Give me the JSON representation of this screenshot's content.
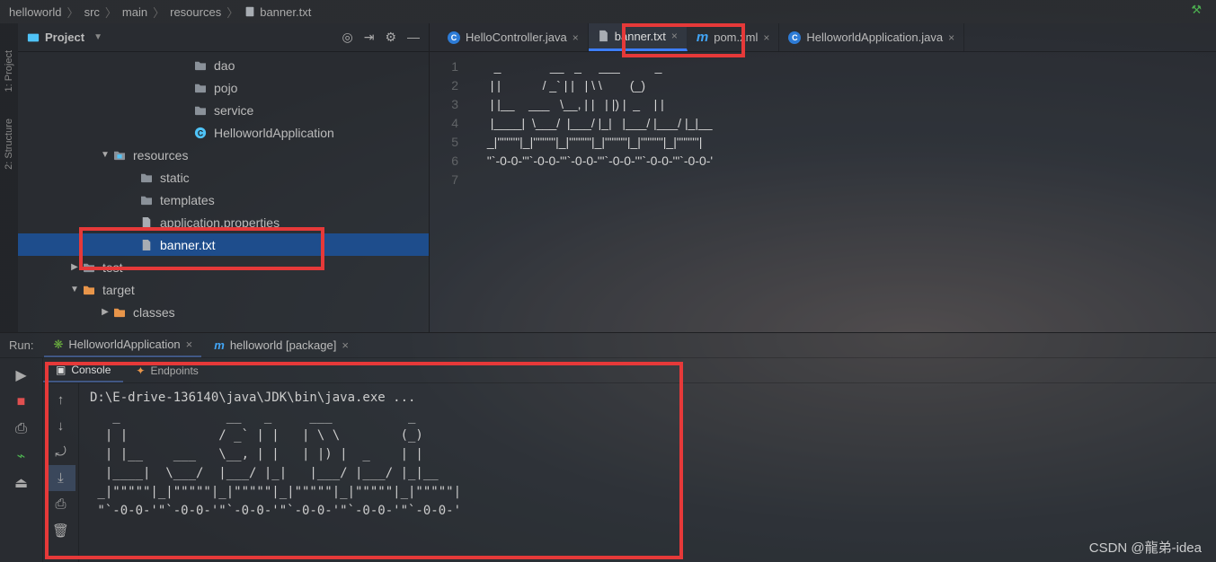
{
  "breadcrumb": {
    "items": [
      "helloworld",
      "src",
      "main",
      "resources",
      "banner.txt"
    ]
  },
  "sidebar": {
    "title": "Project",
    "tree": [
      {
        "label": "dao",
        "icon": "folder",
        "depth": 6
      },
      {
        "label": "pojo",
        "icon": "folder",
        "depth": 6
      },
      {
        "label": "service",
        "icon": "folder",
        "depth": 6
      },
      {
        "label": "HelloworldApplication",
        "icon": "class",
        "depth": 6
      },
      {
        "label": "resources",
        "icon": "folder-res",
        "depth": 4,
        "arrow": "down"
      },
      {
        "label": "static",
        "icon": "folder",
        "depth": 5
      },
      {
        "label": "templates",
        "icon": "folder",
        "depth": 5
      },
      {
        "label": "application.properties",
        "icon": "file",
        "depth": 5
      },
      {
        "label": "banner.txt",
        "icon": "file",
        "depth": 5,
        "selected": true
      },
      {
        "label": "test",
        "icon": "folder",
        "depth": 3,
        "arrow": "right"
      },
      {
        "label": "target",
        "icon": "folder-orange",
        "depth": 3,
        "arrow": "down"
      },
      {
        "label": "classes",
        "icon": "folder-orange",
        "depth": 4,
        "arrow": "right"
      }
    ]
  },
  "tabs": [
    {
      "label": "HelloController.java",
      "icon": "java"
    },
    {
      "label": "banner.txt",
      "icon": "txt",
      "active": true
    },
    {
      "label": "pom.xml",
      "icon": "maven"
    },
    {
      "label": "HelloworldApplication.java",
      "icon": "java"
    }
  ],
  "editor": {
    "lines": [
      "1",
      "2",
      "3",
      "4",
      "5",
      "6",
      "7"
    ],
    "content": "   _              __   _     ___          _\n  | |            / _` | |   | \\ \\        (_)\n  | |__    ___   \\__, | |   | |) |  _    | |\n  |____|  \\___/  |___/ |_|   |___/ |___/ |_|__\n _|\"\"\"\"\"|_|\"\"\"\"\"|_|\"\"\"\"\"|_|\"\"\"\"\"|_|\"\"\"\"\"|_|\"\"\"\"\"|\n \"`-0-0-'\"`-0-0-'\"`-0-0-'\"`-0-0-'\"`-0-0-'\"`-0-0-'\n"
  },
  "run": {
    "label": "Run:",
    "tabs": [
      {
        "label": "HelloworldApplication",
        "icon": "spring",
        "active": true
      },
      {
        "label": "helloworld [package]",
        "icon": "maven"
      }
    ],
    "subtabs": {
      "console": "Console",
      "endpoints": "Endpoints"
    },
    "output": "D:\\E-drive-136140\\java\\JDK\\bin\\java.exe ...\n   _              __   _     ___          _\n  | |            / _` | |   | \\ \\        (_)\n  | |__    ___   \\__, | |   | |) |  _    | |\n  |____|  \\___/  |___/ |_|   |___/ |___/ |_|__\n _|\"\"\"\"\"|_|\"\"\"\"\"|_|\"\"\"\"\"|_|\"\"\"\"\"|_|\"\"\"\"\"|_|\"\"\"\"\"|\n \"`-0-0-'\"`-0-0-'\"`-0-0-'\"`-0-0-'\"`-0-0-'\"`-0-0-'"
  },
  "left_gutter": {
    "project": "1: Project",
    "structure": "2: Structure"
  },
  "watermark": "CSDN @龍弟-idea"
}
